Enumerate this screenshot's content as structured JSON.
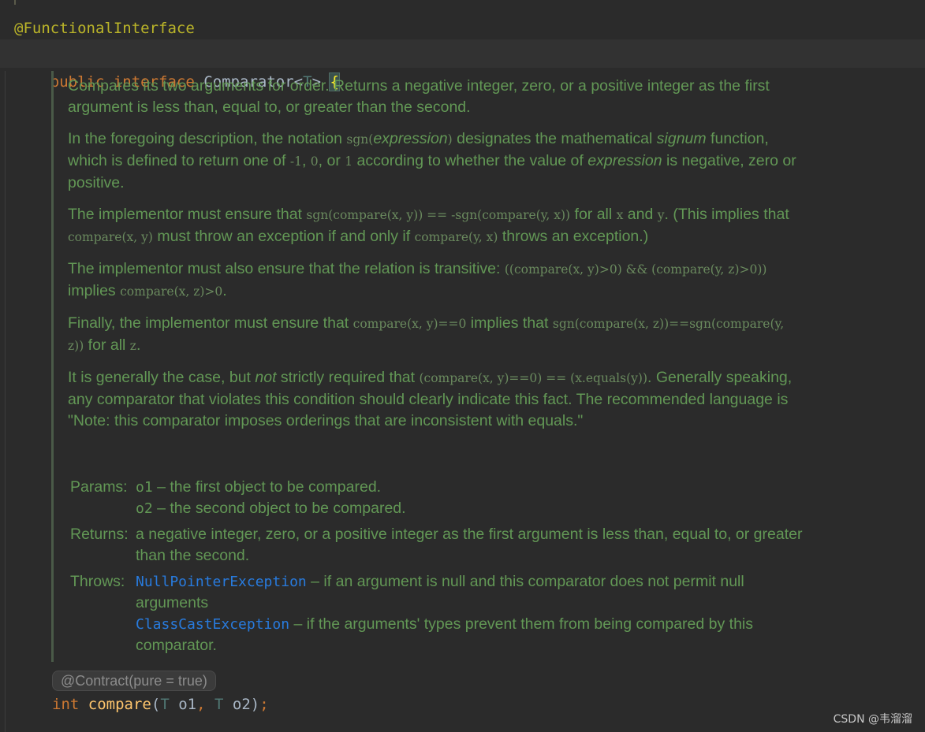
{
  "editor": {
    "annotation": "@FunctionalInterface",
    "declaration": {
      "kw_public": "public",
      "kw_interface": "interface",
      "name": "Comparator",
      "lt": "<",
      "type_param": "T",
      "gt": ">",
      "brace": "{"
    },
    "javadoc": {
      "p1": "Compares its two arguments for order. Returns a negative integer, zero, or a positive integer as the first argument is less than, equal to, or greater than the second.",
      "p2": {
        "t1": "In the foregoing description, the notation ",
        "c1": "sgn(",
        "e1": "expression",
        "c2": ")",
        "t2": " designates the mathematical ",
        "e2": "signum",
        "t3": " function, which is defined to return one of ",
        "c3": "-1",
        "t4": ", ",
        "c4": "0",
        "t5": ", or ",
        "c5": "1",
        "t6": " according to whether the value of ",
        "e3": "expression",
        "t7": " is negative, zero or positive."
      },
      "p3": {
        "t1": "The implementor must ensure that ",
        "c1": "sgn(compare(x, y)) == -sgn(compare(y, x))",
        "t2": " for all ",
        "c2": "x",
        "t3": " and ",
        "c3": "y",
        "t4": ". (This implies that ",
        "c4": "compare(x, y)",
        "t5": " must throw an exception if and only if ",
        "c5": "compare(y, x)",
        "t6": " throws an exception.)"
      },
      "p4": {
        "t1": "The implementor must also ensure that the relation is transitive: ",
        "c1": "((compare(x, y)>0) && (compare(y, z)>0))",
        "t2": " implies ",
        "c2": "compare(x, z)>0",
        "t3": "."
      },
      "p5": {
        "t1": "Finally, the implementor must ensure that ",
        "c1": "compare(x, y)==0",
        "t2": " implies that ",
        "c2": "sgn(compare(x, z))==sgn(compare(y, z))",
        "t3": " for all ",
        "c3": "z",
        "t4": "."
      },
      "p6": {
        "t1": "It is generally the case, but ",
        "e1": "not",
        "t2": " strictly required that ",
        "c1": "(compare(x, y)==0) == (x.equals(y))",
        "t3": ". Generally speaking, any comparator that violates this condition should clearly indicate this fact. The recommended language is \"Note: this comparator imposes orderings that are inconsistent with equals.\""
      },
      "params": {
        "label": "Params:",
        "o1_name": "o1",
        "o1_desc": " – the first object to be compared.",
        "o2_name": "o2",
        "o2_desc": " – the second object to be compared."
      },
      "returns": {
        "label": "Returns:",
        "desc": "a negative integer, zero, or a positive integer as the first argument is less than, equal to, or greater than the second."
      },
      "throws": {
        "label": "Throws:",
        "ex1": "NullPointerException",
        "ex1_desc": " – if an argument is null and this comparator does not permit null arguments",
        "ex2": "ClassCastException",
        "ex2_desc": " – if the arguments' types prevent them from being compared by this comparator."
      }
    },
    "contract_hint": "@Contract(pure = true)",
    "method": {
      "ret": "int",
      "name": "compare",
      "open": "(",
      "t1": "T",
      "p1": " o1",
      "comma": ",",
      "t2": " T",
      "p2": " o2",
      "close": ")",
      "semi": ";"
    }
  },
  "watermark": "CSDN @韦溜溜",
  "colors": {
    "background": "#2b2b2b",
    "doc_text": "#629755",
    "keyword": "#cc7832",
    "method_name": "#ffc66d",
    "link": "#287bde",
    "annotation": "#bbb529"
  }
}
